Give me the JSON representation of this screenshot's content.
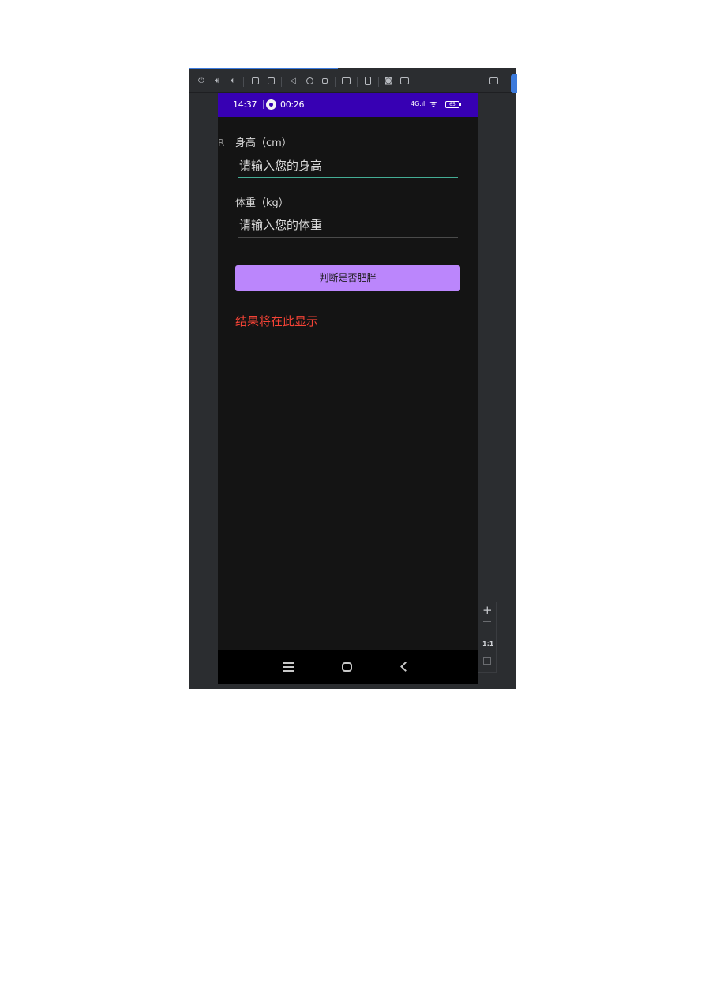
{
  "toolbar": {
    "icons": [
      "power-icon",
      "volume-up-icon",
      "volume-down-icon",
      "rotate-left-icon",
      "rotate-right-icon",
      "back-icon",
      "home-icon",
      "overview-icon",
      "fold-icon",
      "device-icon",
      "camera-icon",
      "record-icon",
      "settings-icon"
    ]
  },
  "status_bar": {
    "time": "14:37",
    "timer": "00:26",
    "signal": "4G.ıl",
    "wifi": "ᯤ",
    "battery": "65"
  },
  "form": {
    "cut_letter": "R",
    "height_label": "身高（cm）",
    "height_placeholder": "请输入您的身高",
    "weight_label": "体重（kg）",
    "weight_placeholder": "请输入您的体重",
    "button_label": "判断是否肥胖",
    "result_text": "结果将在此显示"
  },
  "zoom_controls": {
    "plus": "+",
    "ratio": "1:1"
  },
  "colors": {
    "status_bar": "#3700b3",
    "button": "#bb86fc",
    "result": "#f44336",
    "focused_underline": "#44ad95"
  }
}
